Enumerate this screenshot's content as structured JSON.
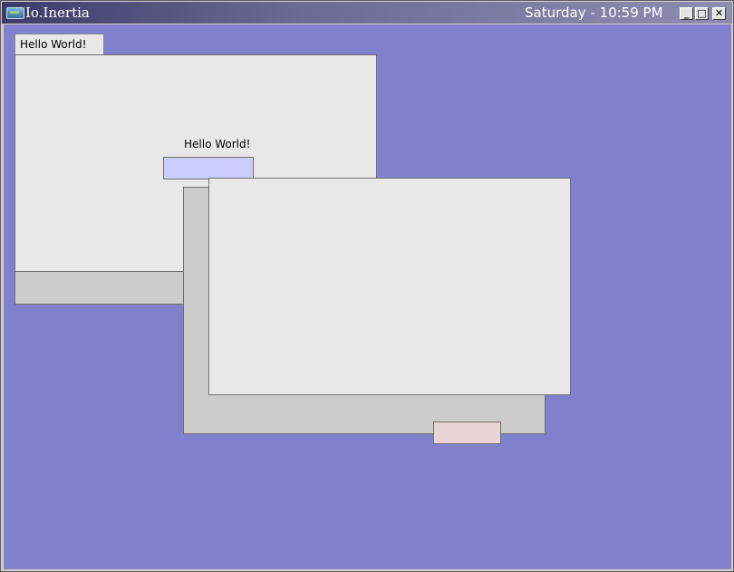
{
  "window": {
    "title": "Io.Inertia",
    "clock": "Saturday - 10:59 PM",
    "controls": {
      "minimize": "_",
      "maximize": "□",
      "close": "✕"
    }
  },
  "panel1": {
    "tab_label": "Hello  World!",
    "label": "Hello  World!"
  },
  "colors": {
    "desktop": "#8080cc",
    "panel_body": "#e8e8e8",
    "panel_footer": "#cccccc",
    "button_blue": "#ccccff",
    "button_pink": "#e8d4d4"
  }
}
